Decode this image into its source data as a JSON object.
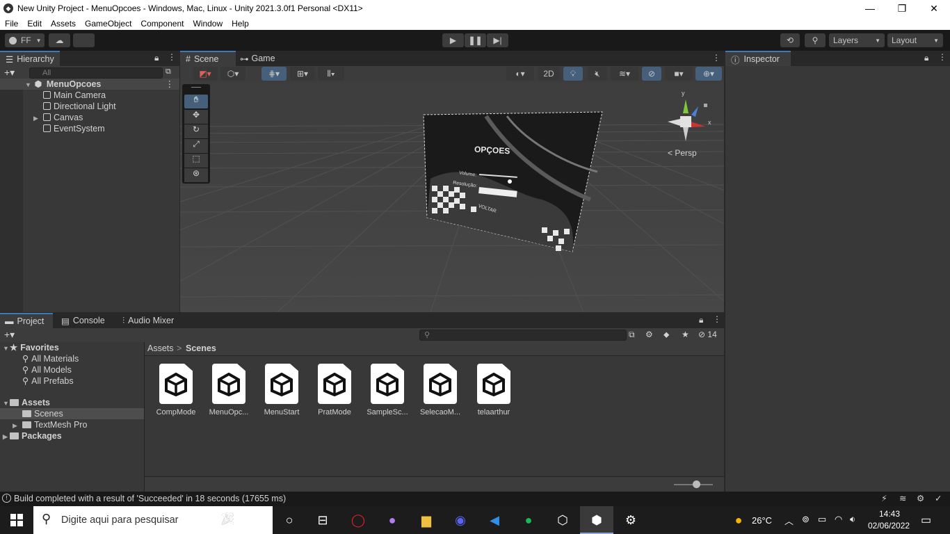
{
  "window": {
    "title": "New Unity Project - MenuOpcoes - Windows, Mac, Linux - Unity 2021.3.0f1 Personal <DX11>",
    "minimize": "—",
    "maximize": "❐",
    "close": "✕"
  },
  "menu": [
    "File",
    "Edit",
    "Assets",
    "GameObject",
    "Component",
    "Window",
    "Help"
  ],
  "toolbar": {
    "account": "FF",
    "layers": "Layers",
    "layout": "Layout"
  },
  "hierarchy": {
    "tab": "Hierarchy",
    "search_placeholder": "All",
    "scene": "MenuOpcoes",
    "items": [
      {
        "label": "Main Camera"
      },
      {
        "label": "Directional Light"
      },
      {
        "label": "Canvas"
      },
      {
        "label": "EventSystem"
      }
    ]
  },
  "scene": {
    "tab_scene": "Scene",
    "tab_game": "Game",
    "toggle_2d": "2D",
    "persp": "< Persp",
    "gizmo_y": "y",
    "gizmo_x": "x",
    "canvas_title": "OPÇOES",
    "canvas_volume": "Volume:",
    "canvas_resolution": "Resolução:",
    "canvas_back": "VOLTAR"
  },
  "inspector": {
    "tab": "Inspector"
  },
  "project": {
    "tabs": [
      "Project",
      "Console",
      "Audio Mixer"
    ],
    "hidden_count": "14",
    "breadcrumb_root": "Assets",
    "breadcrumb_sep": ">",
    "breadcrumb_current": "Scenes",
    "favorites": {
      "label": "Favorites",
      "items": [
        "All Materials",
        "All Models",
        "All Prefabs"
      ]
    },
    "assets": {
      "label": "Assets",
      "items": [
        "Scenes",
        "TextMesh Pro"
      ]
    },
    "packages": "Packages",
    "files": [
      "CompMode",
      "MenuOpc...",
      "MenuStart",
      "PratMode",
      "SampleSc...",
      "SelecaoM...",
      "telaarthur"
    ]
  },
  "status": {
    "message": "Build completed with a result of 'Succeeded' in 18 seconds (17655 ms)"
  },
  "taskbar": {
    "search_placeholder": "Digite aqui para pesquisar",
    "temperature": "26°C",
    "time": "14:43",
    "date": "02/06/2022"
  },
  "colors": {
    "accent": "#3a79bb",
    "panel": "#383838",
    "dark": "#191919"
  }
}
